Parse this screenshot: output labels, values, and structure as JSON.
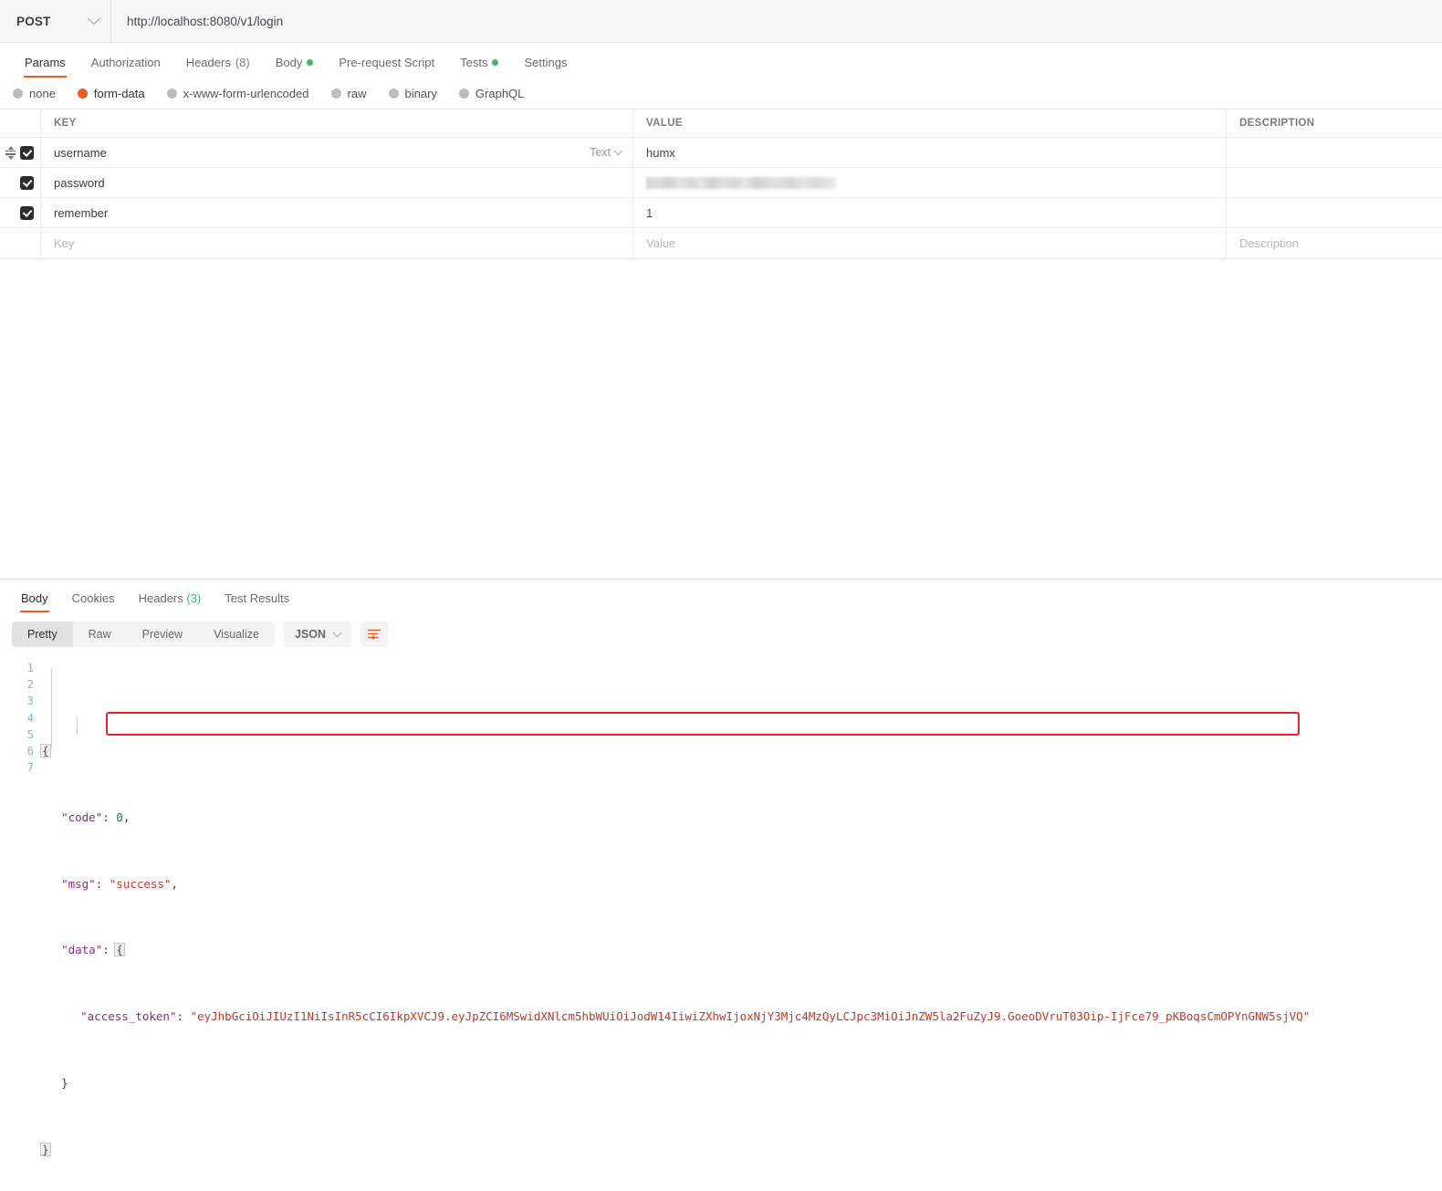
{
  "request": {
    "method": "POST",
    "url": "http://localhost:8080/v1/login",
    "tabs": [
      {
        "label": "Params",
        "count": "",
        "dot": false,
        "active": false
      },
      {
        "label": "Authorization",
        "count": "",
        "dot": false,
        "active": false
      },
      {
        "label": "Headers",
        "count": "(8)",
        "dot": false,
        "active": false
      },
      {
        "label": "Body",
        "count": "",
        "dot": true,
        "active": true
      },
      {
        "label": "Pre-request Script",
        "count": "",
        "dot": false,
        "active": false
      },
      {
        "label": "Tests",
        "count": "",
        "dot": true,
        "active": false
      },
      {
        "label": "Settings",
        "count": "",
        "dot": false,
        "active": false
      }
    ],
    "body_types": [
      {
        "label": "none",
        "selected": false
      },
      {
        "label": "form-data",
        "selected": true
      },
      {
        "label": "x-www-form-urlencoded",
        "selected": false
      },
      {
        "label": "raw",
        "selected": false
      },
      {
        "label": "binary",
        "selected": false
      },
      {
        "label": "GraphQL",
        "selected": false
      }
    ],
    "table": {
      "headers": {
        "key": "KEY",
        "value": "VALUE",
        "description": "DESCRIPTION"
      },
      "type_selector": "Text",
      "rows": [
        {
          "checked": true,
          "key": "username",
          "value": "humx",
          "description": "",
          "masked": false,
          "has_type": true,
          "has_handle": true
        },
        {
          "checked": true,
          "key": "password",
          "value": "",
          "description": "",
          "masked": true,
          "has_type": false,
          "has_handle": false
        },
        {
          "checked": true,
          "key": "remember",
          "value": "1",
          "description": "",
          "masked": false,
          "has_type": false,
          "has_handle": false
        }
      ],
      "empty_row": {
        "key": "Key",
        "value": "Value",
        "description": "Description"
      }
    }
  },
  "response": {
    "tabs": [
      {
        "label": "Body",
        "count": "",
        "active": true
      },
      {
        "label": "Cookies",
        "count": "",
        "active": false
      },
      {
        "label": "Headers",
        "count": "(3)",
        "active": false
      },
      {
        "label": "Test Results",
        "count": "",
        "active": false
      }
    ],
    "view_modes": [
      {
        "label": "Pretty",
        "active": true
      },
      {
        "label": "Raw",
        "active": false
      },
      {
        "label": "Preview",
        "active": false
      },
      {
        "label": "Visualize",
        "active": false
      }
    ],
    "format": "JSON",
    "wrap_icon": "wrap-text-icon",
    "body": {
      "line_numbers": [
        "1",
        "2",
        "3",
        "4",
        "5",
        "6",
        "7"
      ],
      "code": {
        "code_key": "\"code\"",
        "code_value": "0",
        "msg_key": "\"msg\"",
        "msg_value": "\"success\"",
        "data_key": "\"data\"",
        "token_key": "\"access_token\"",
        "token_value": "\"eyJhbGciOiJIUzI1NiIsInR5cCI6IkpXVCJ9.eyJpZCI6MSwidXNlcm5hbWUiOiJodW14IiwiZXhwIjoxNjY3Mjc4MzQyLCJpc3MiOiJnZW5la2FuZyJ9.GoeoDVruT03Oip-IjFce79_pKBoqsCmOPYnGNW5sjVQ\""
      }
    }
  },
  "colors": {
    "accent": "#ef5b25",
    "green_dot": "#3dbb64",
    "annotation": "#e8242a",
    "line_number": "#8ab4dd"
  }
}
